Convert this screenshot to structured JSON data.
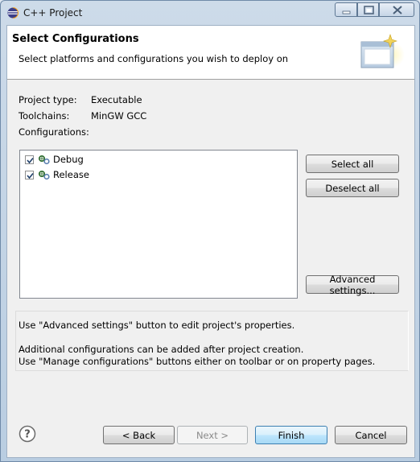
{
  "window": {
    "title": "C++ Project"
  },
  "banner": {
    "title": "Select Configurations",
    "description": "Select platforms and configurations you wish to deploy on"
  },
  "project": {
    "type_label": "Project type:",
    "type_value": "Executable",
    "toolchains_label": "Toolchains:",
    "toolchains_value": "MinGW GCC",
    "configurations_label": "Configurations:"
  },
  "configurations": [
    {
      "name": "Debug",
      "checked": true
    },
    {
      "name": "Release",
      "checked": true
    }
  ],
  "side_buttons": {
    "select_all": "Select all",
    "deselect_all": "Deselect all",
    "advanced_settings": "Advanced settings..."
  },
  "info": {
    "line1": "Use \"Advanced settings\" button to edit project's properties.",
    "line2": "Additional configurations can be added after project creation.",
    "line3": "Use \"Manage configurations\" buttons either on toolbar or on property pages."
  },
  "footer": {
    "back": "< Back",
    "next": "Next >",
    "finish": "Finish",
    "cancel": "Cancel"
  },
  "icons": {
    "app": "eclipse-cdt-icon",
    "configuration": "build-configuration-icon",
    "help": "help-icon"
  },
  "colors": {
    "default_button_border": "#3c7fb1",
    "list_border": "#828790"
  }
}
